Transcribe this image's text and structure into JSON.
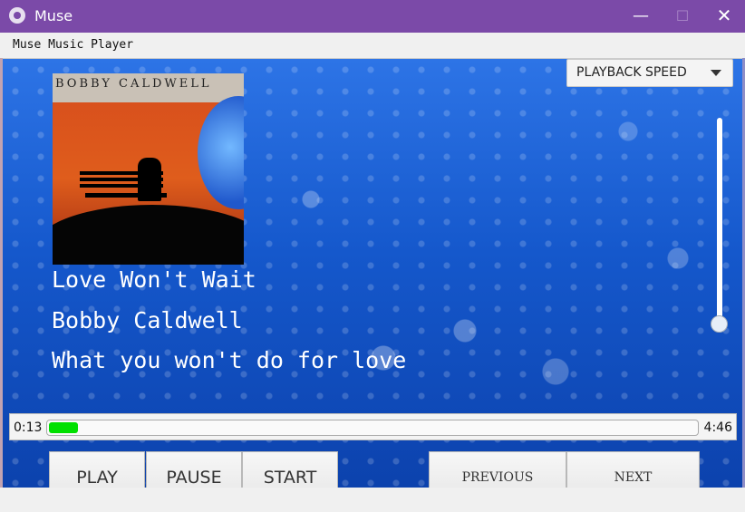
{
  "window": {
    "title": "Muse",
    "minimize_symbol": "—",
    "maximize_symbol": "☐",
    "close_symbol": "✕"
  },
  "menu": {
    "label": "Muse Music Player"
  },
  "album": {
    "text": "BOBBY CALDWELL"
  },
  "song": {
    "title": "Love Won't Wait",
    "artist": "Bobby Caldwell",
    "album": "What you won't do for love"
  },
  "controls": {
    "playback_speed": "PLAYBACK SPEED",
    "current_time": "0:13",
    "total_time": "4:46",
    "progress_fraction": 0.045,
    "volume_fraction": 0.0,
    "play": "PLAY",
    "pause": "PAUSE",
    "start": "START",
    "previous": "PREVIOUS",
    "next": "NEXT"
  },
  "colors": {
    "title_bar": "#7b4aa8",
    "progress": "#00e000",
    "background": "#1558cc"
  },
  "icons": {
    "app": "app-icon",
    "dropdown": "chevron-down-icon"
  }
}
